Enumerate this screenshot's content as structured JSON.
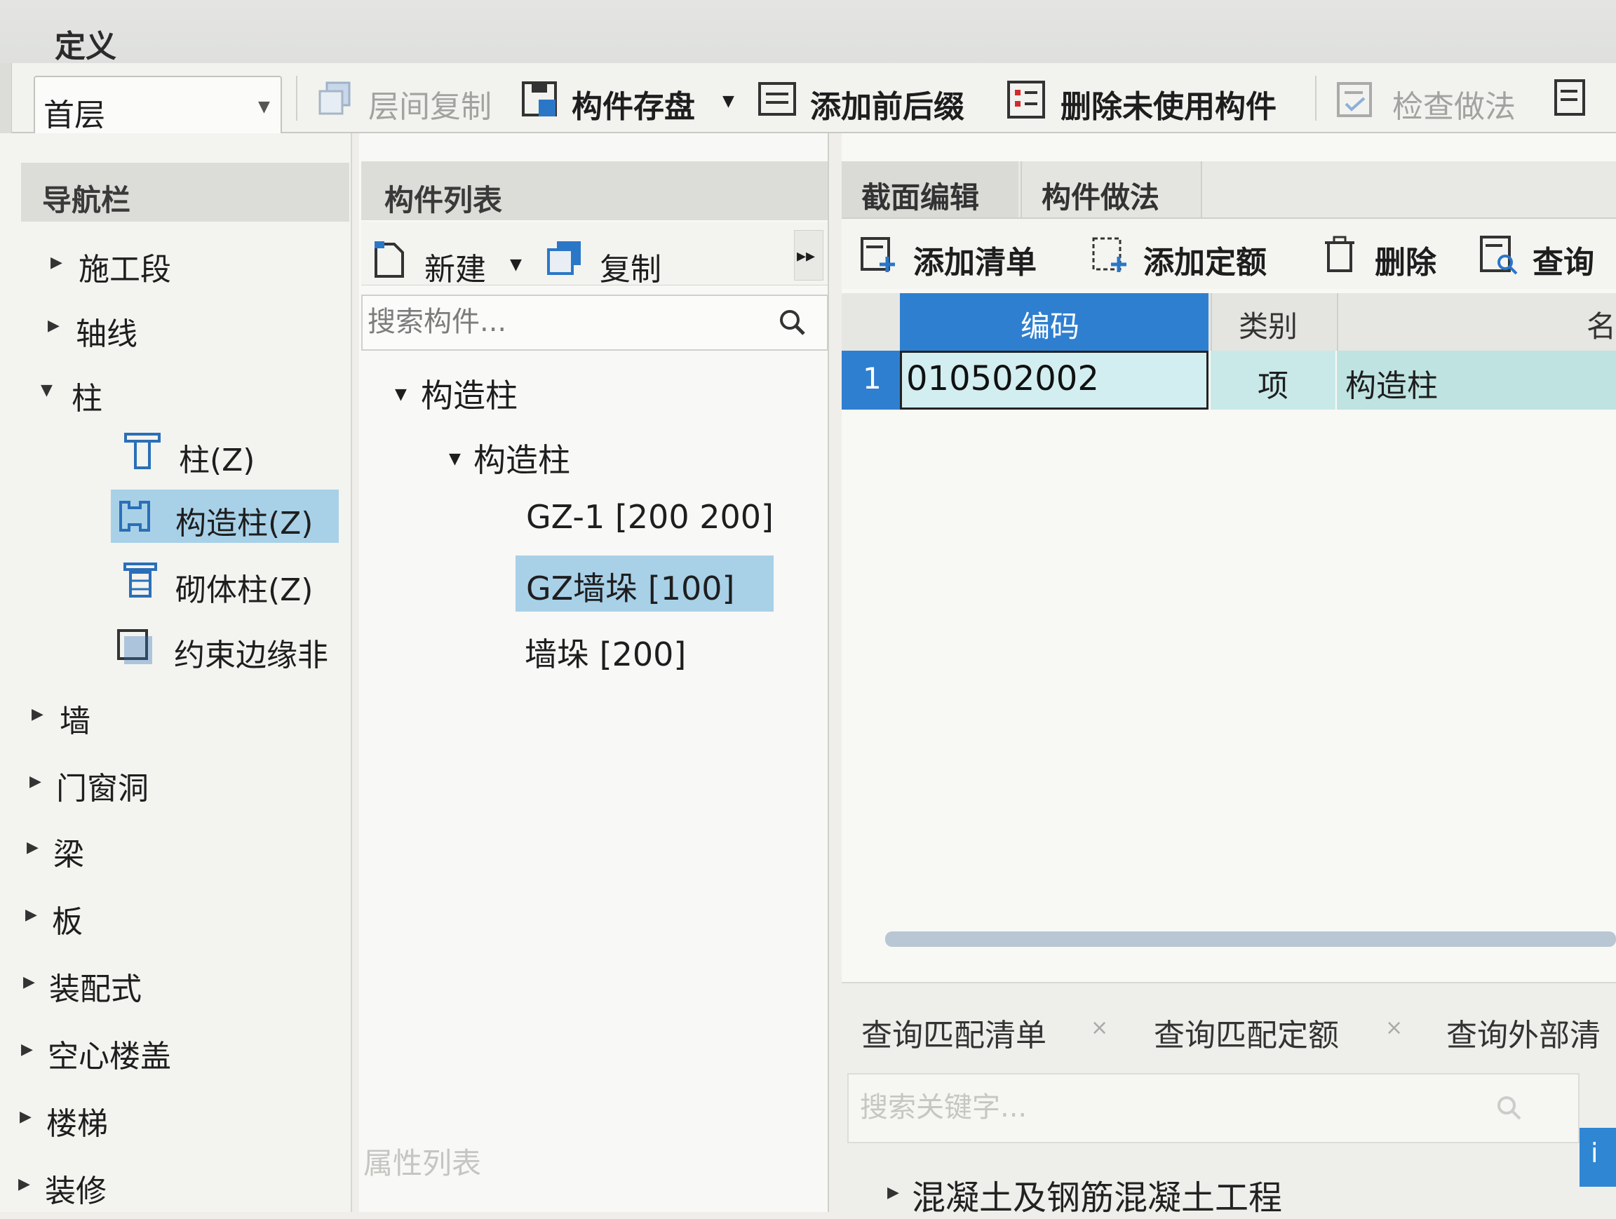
{
  "window": {
    "title": "定义"
  },
  "toolbar": {
    "floor_value": "首层",
    "items": [
      {
        "label": "层间复制",
        "enabled": false
      },
      {
        "label": "构件存盘",
        "enabled": true
      },
      {
        "label": "添加前后缀",
        "enabled": true
      },
      {
        "label": "删除未使用构件",
        "enabled": true
      },
      {
        "label": "检查做法",
        "enabled": false
      }
    ]
  },
  "nav": {
    "title": "导航栏",
    "items": [
      {
        "label": "施工段"
      },
      {
        "label": "轴线"
      },
      {
        "label": "柱"
      },
      {
        "label": "柱(Z)"
      },
      {
        "label": "构造柱(Z)"
      },
      {
        "label": "砌体柱(Z)"
      },
      {
        "label": "约束边缘非"
      },
      {
        "label": "墙"
      },
      {
        "label": "门窗洞"
      },
      {
        "label": "梁"
      },
      {
        "label": "板"
      },
      {
        "label": "装配式"
      },
      {
        "label": "空心楼盖"
      },
      {
        "label": "楼梯"
      },
      {
        "label": "装修"
      }
    ],
    "selected": "构造柱(Z)"
  },
  "components": {
    "title": "构件列表",
    "new_label": "新建",
    "copy_label": "复制",
    "more_label": "▸▸",
    "search_placeholder": "搜索构件...",
    "tree": [
      {
        "label": "构造柱"
      },
      {
        "label": "构造柱"
      },
      {
        "label": "GZ-1 [200 200]"
      },
      {
        "label": "GZ墙垛 [100]"
      },
      {
        "label": "墙垛 [200]"
      }
    ],
    "selected": "GZ墙垛 [100]",
    "properties_title": "属性列表"
  },
  "right": {
    "tabs": [
      {
        "label": "截面编辑",
        "active": false
      },
      {
        "label": "构件做法",
        "active": true
      }
    ],
    "toolbar": [
      {
        "label": "添加清单"
      },
      {
        "label": "添加定额"
      },
      {
        "label": "删除"
      },
      {
        "label": "查询"
      }
    ],
    "grid": {
      "columns": [
        "编码",
        "类别",
        "名"
      ],
      "rows": [
        {
          "num": "1",
          "code": "010502002",
          "type": "项",
          "name": "构造柱"
        }
      ]
    },
    "query_tabs": [
      "查询匹配清单",
      "查询匹配定额",
      "查询外部清"
    ],
    "keyword_placeholder": "搜索关键字...",
    "side_button": "i",
    "result_tree_item": "混凝土及钢筋混凝土工程"
  },
  "colors": {
    "selection_blue": "#2f7fd0",
    "selected_row": "#a8d1e8",
    "accent_cyan": "#bfe3e1"
  }
}
